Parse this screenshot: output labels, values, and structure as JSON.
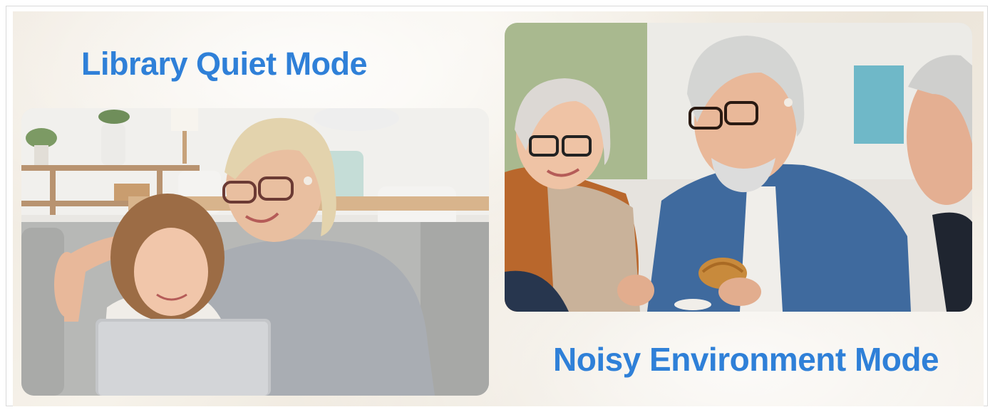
{
  "library_mode": {
    "title": "Library Quiet Mode",
    "photo_subject": "grandmother and granddaughter looking at a laptop on a couch"
  },
  "noisy_mode": {
    "title": "Noisy Environment Mode",
    "photo_subject": "three seniors chatting at a cafe table with a croissant"
  },
  "colors": {
    "title_blue": "#2f80d8",
    "background_cream": "#efe8dd"
  }
}
